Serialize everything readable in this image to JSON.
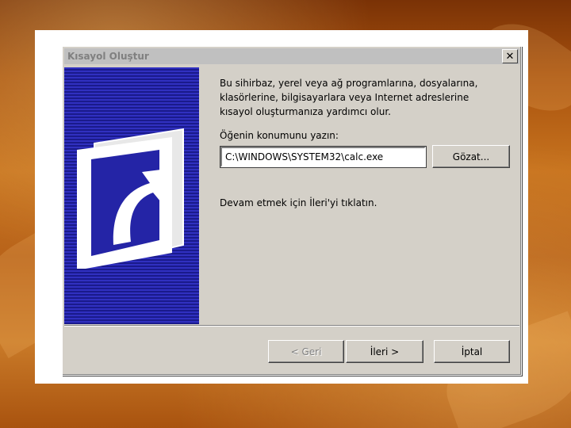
{
  "dialog": {
    "title": "Kısayol Oluştur",
    "close_label": "✕"
  },
  "content": {
    "intro_lines": [
      "Bu sihirbaz, yerel veya ağ programlarına, dosyalarına,",
      "klasörlerine, bilgisayarlara veya Internet adreslerine",
      "kısayol oluşturmanıza yardımcı olur."
    ],
    "prompt": "Öğenin konumunu yazın:",
    "location_value": "C:\\WINDOWS\\SYSTEM32\\calc.exe",
    "browse_label": "Gözat...",
    "continue_text": "Devam etmek için İleri'yi tıklatın."
  },
  "buttons": {
    "back_label": "< Geri",
    "next_label": "İleri >",
    "cancel_label": "İptal"
  },
  "colors": {
    "panel_blue": "#2424a6",
    "dialog_gray": "#d4d0c8"
  }
}
